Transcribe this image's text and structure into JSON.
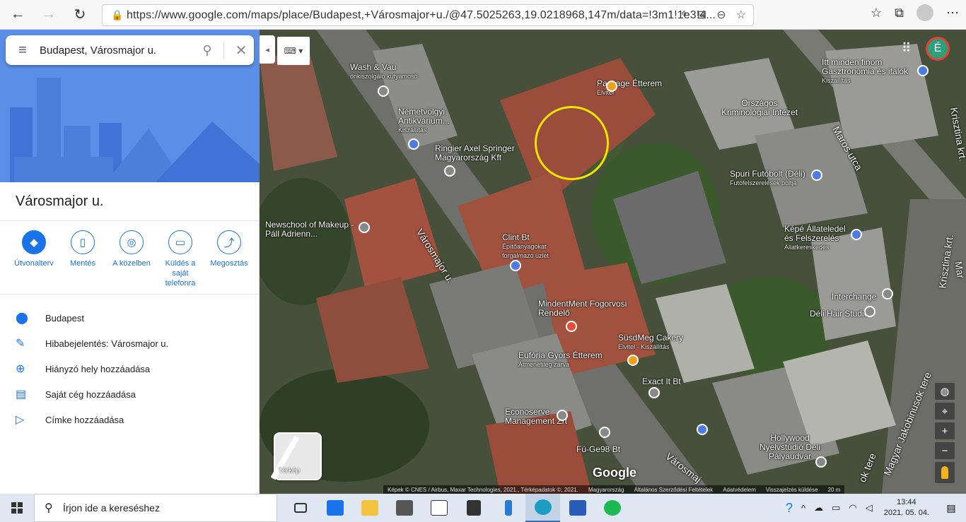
{
  "browser": {
    "url": "https://www.google.com/maps/place/Budapest,+Városmajor+u./@47.5025263,19.0218968,147m/data=!3m1!1e3!4...",
    "back_icon": "←",
    "forward_icon": "→",
    "refresh_icon": "↻"
  },
  "search": {
    "value": "Budapest, Városmajor u."
  },
  "place": {
    "title": "Városmajor u."
  },
  "actions": [
    {
      "label": "Útvonalterv",
      "icon": "directions-icon"
    },
    {
      "label": "Mentés",
      "icon": "bookmark-icon"
    },
    {
      "label": "A közelben",
      "icon": "nearby-icon"
    },
    {
      "label": "Küldés a saját telefonra",
      "icon": "phone-icon"
    },
    {
      "label": "Megosztás",
      "icon": "share-icon"
    }
  ],
  "info_items": [
    {
      "text": "Budapest",
      "icon": "pin-icon"
    },
    {
      "text": "Hibabejelentés: Városmajor u.",
      "icon": "pencil-icon"
    },
    {
      "text": "Hiányzó hely hozzáadása",
      "icon": "add-place-icon"
    },
    {
      "text": "Saját cég hozzáadása",
      "icon": "add-business-icon"
    },
    {
      "text": "Címke hozzáadása",
      "icon": "label-icon"
    }
  ],
  "map": {
    "layer_label": "Térkép",
    "profile_initial": "É",
    "logo": "Google",
    "labels": [
      {
        "name": "Wash & Vau",
        "sub": "önkiszolgáló kutyamosó"
      },
      {
        "name": "Passage Étterem",
        "sub": "Elvitel"
      },
      {
        "name": "Németvölgyi Antikvárium...",
        "sub": "Kiszállítás"
      },
      {
        "name": "Ringier Axel Springer Magyarország Kft",
        "sub": ""
      },
      {
        "name": "Országos Kriminológiai Intézet",
        "sub": ""
      },
      {
        "name": "Itt minden finom Gasztronómia és italok",
        "sub": "Kiszállítás"
      },
      {
        "name": "Spuri Futóbolt (Déli)",
        "sub": "Futófelszerelések boltja"
      },
      {
        "name": "Newschool of Makeup - Páll Adrienn...",
        "sub": ""
      },
      {
        "name": "Clint Bt",
        "sub": "Építőanyagokat forgalmazó üzlet"
      },
      {
        "name": "Képé Állateledel és Felszerelés",
        "sub": "Állatkereskedés"
      },
      {
        "name": "Interchange",
        "sub": ""
      },
      {
        "name": "Déli Hair Studio",
        "sub": ""
      },
      {
        "name": "MindentMent Fogorvosi Rendelő",
        "sub": ""
      },
      {
        "name": "SüsdMeg Cakery",
        "sub": "Elvitel · Kiszállítás"
      },
      {
        "name": "Eufória Gyors Étterem",
        "sub": "Átmenetileg zárva"
      },
      {
        "name": "Exact It Bt",
        "sub": ""
      },
      {
        "name": "Econoserve Management Zrt",
        "sub": ""
      },
      {
        "name": "Fü-Ge98 Bt",
        "sub": ""
      },
      {
        "name": "Hollywood Nyelvstúdió Déli Pályaudvar",
        "sub": ""
      }
    ],
    "streets": [
      "Városmajor u.",
      "Városmaj",
      "Maros utca",
      "Krisztina krt.",
      "Krisztina krt.",
      "Mar",
      "Magyar Jakobinusok tere",
      "ok tere"
    ],
    "attribution": [
      "Képek © CNES / Airbus, Maxar Technologies, 2021., Térképadatok ©, 2021.",
      "Magyarország",
      "Általános Szerződési Feltételek",
      "Adatvédelem",
      "Visszajelzés küldése",
      "20 m"
    ]
  },
  "taskbar": {
    "search_placeholder": "Írjon ide a kereséshez",
    "time": "13:44",
    "date": "2021. 05. 04."
  }
}
